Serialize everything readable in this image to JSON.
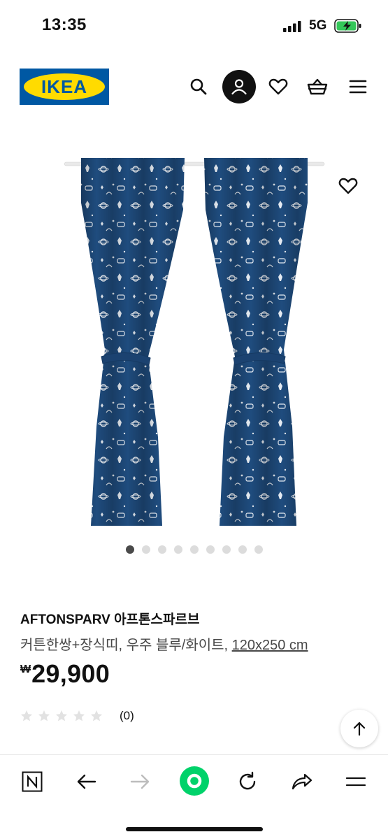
{
  "status_bar": {
    "time": "13:35",
    "network": "5G"
  },
  "header": {
    "logo_text": "IKEA",
    "icons": [
      "search-icon",
      "account-icon",
      "heart-icon",
      "cart-icon",
      "menu-icon"
    ]
  },
  "gallery": {
    "image_count": 9,
    "active_index": 0
  },
  "product": {
    "name": "AFTONSPARV 아프톤스파르브",
    "description": "커튼한쌍+장식띠, 우주 블루/화이트, ",
    "size": "120x250 cm",
    "currency_symbol": "₩",
    "price": "29,900",
    "rating": 0,
    "max_rating": 5,
    "review_count": "(0)"
  },
  "colors": {
    "ikea_blue": "#0058A3",
    "ikea_yellow": "#FFDB00",
    "curtain_blue": "#1e4a7a",
    "accent_green": "#00c853"
  },
  "browser_bar": {
    "icons": [
      "naver-n-icon",
      "back-arrow-icon",
      "forward-arrow-icon",
      "green-dot-icon",
      "reload-icon",
      "share-icon",
      "hamburger-icon"
    ]
  }
}
